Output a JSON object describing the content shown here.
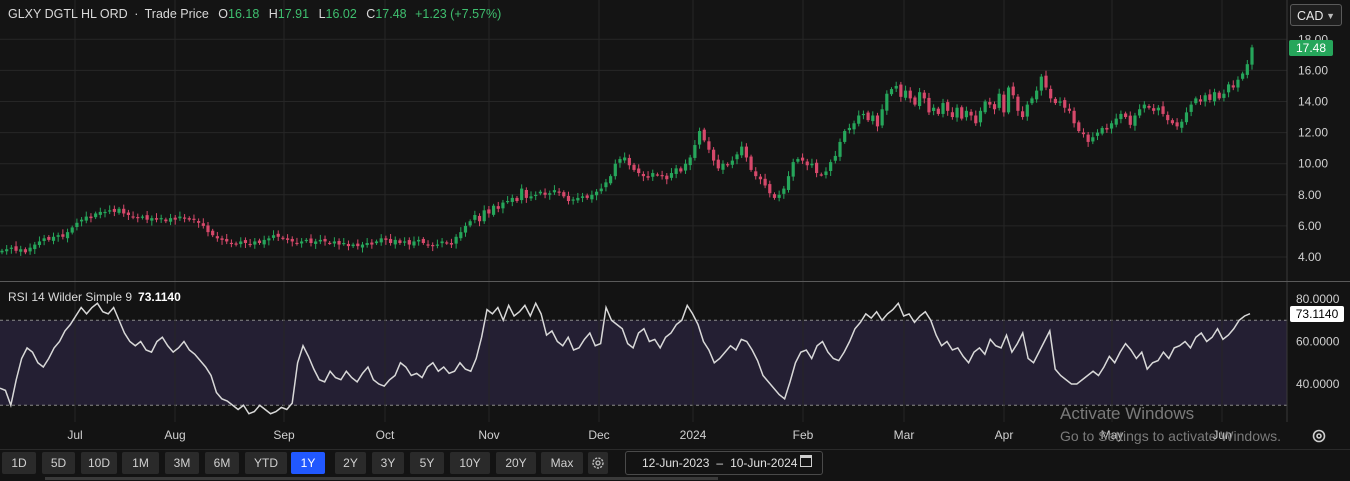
{
  "header": {
    "symbol": "GLXY DGTL HL ORD",
    "price_type": "Trade Price",
    "open_label": "O",
    "open": "16.18",
    "high_label": "H",
    "high": "17.91",
    "low_label": "L",
    "low": "16.02",
    "close_label": "C",
    "close": "17.48",
    "change": "+1.23 (+7.57%)",
    "currency": "CAD"
  },
  "rsi_legend": {
    "label": "RSI 14 Wilder Simple 9",
    "value": "73.1140"
  },
  "badges": {
    "price": "17.48",
    "rsi": "73.1140"
  },
  "toolbar": {
    "timeframes": [
      "1D",
      "5D",
      "10D",
      "1M",
      "3M",
      "6M",
      "YTD",
      "1Y",
      "2Y",
      "3Y",
      "5Y",
      "10Y",
      "20Y",
      "Max"
    ],
    "active": "1Y",
    "range_start": "12-Jun-2023",
    "range_sep": "–",
    "range_end": "10-Jun-2024"
  },
  "watermark": {
    "line1": "Activate Windows",
    "line2": "Go to Settings to activate Windows."
  },
  "colors": {
    "up": "#26a65b",
    "down": "#d6496b",
    "rsi_line": "#d8d8d8",
    "rsi_band": "#241f33",
    "active_button": "#2158ff"
  },
  "chart_data": [
    {
      "type": "candlestick",
      "title": "GLXY DGTL HL ORD · Trade Price",
      "x_tick_labels": [
        "Jul",
        "Aug",
        "Sep",
        "Oct",
        "Nov",
        "Dec",
        "2024",
        "Feb",
        "Mar",
        "Apr",
        "May",
        "Jun"
      ],
      "y_tick_labels": [
        "4.00",
        "6.00",
        "8.00",
        "10.00",
        "12.00",
        "14.00",
        "16.00",
        "18.00"
      ],
      "ylim": [
        3,
        18.5
      ],
      "close_series": [
        4.4,
        4.5,
        4.6,
        4.4,
        4.5,
        4.3,
        4.6,
        4.8,
        5.0,
        5.2,
        5.1,
        5.3,
        5.4,
        5.3,
        5.6,
        5.9,
        6.2,
        6.4,
        6.6,
        6.5,
        6.8,
        6.9,
        6.9,
        7.0,
        6.9,
        7.1,
        6.8,
        6.7,
        6.6,
        6.5,
        6.6,
        6.4,
        6.5,
        6.4,
        6.5,
        6.3,
        6.5,
        6.4,
        6.6,
        6.5,
        6.4,
        6.4,
        6.2,
        6.0,
        5.6,
        5.4,
        5.2,
        5.1,
        5.0,
        4.9,
        4.8,
        5.0,
        4.9,
        4.8,
        5.0,
        4.9,
        5.1,
        5.2,
        5.4,
        5.3,
        5.2,
        5.1,
        5.0,
        4.9,
        5.0,
        5.1,
        4.9,
        5.0,
        5.1,
        5.0,
        4.9,
        5.0,
        4.8,
        4.9,
        4.7,
        4.8,
        4.7,
        4.8,
        4.9,
        4.8,
        5.0,
        5.2,
        5.1,
        4.9,
        5.1,
        4.9,
        5.0,
        4.8,
        5.0,
        5.1,
        4.9,
        4.8,
        4.7,
        4.8,
        5.0,
        4.9,
        4.8,
        5.3,
        5.6,
        6.0,
        6.3,
        6.7,
        6.3,
        7.0,
        6.8,
        7.3,
        7.1,
        7.5,
        7.6,
        7.8,
        7.6,
        8.4,
        7.8,
        7.9,
        8.0,
        8.2,
        8.0,
        8.1,
        8.3,
        8.2,
        7.9,
        7.6,
        7.7,
        7.8,
        7.9,
        7.8,
        8.0,
        8.2,
        8.4,
        8.8,
        9.2,
        10.0,
        10.3,
        10.4,
        9.9,
        9.6,
        9.4,
        9.2,
        9.1,
        9.4,
        9.3,
        9.2,
        9.0,
        9.4,
        9.7,
        9.5,
        10.0,
        10.4,
        11.2,
        12.1,
        11.5,
        10.9,
        10.2,
        9.7,
        10.0,
        9.9,
        10.2,
        10.6,
        11.1,
        10.4,
        9.6,
        9.2,
        9.0,
        8.6,
        8.1,
        7.8,
        8.0,
        8.4,
        9.2,
        10.1,
        10.3,
        10.2,
        9.9,
        10.0,
        9.4,
        9.3,
        9.5,
        10.1,
        10.5,
        11.4,
        12.1,
        12.3,
        12.6,
        13.1,
        13.2,
        12.8,
        13.1,
        12.4,
        13.5,
        14.5,
        14.8,
        15.0,
        14.3,
        14.7,
        14.2,
        13.8,
        14.6,
        14.2,
        13.3,
        13.6,
        13.2,
        13.9,
        13.4,
        13.0,
        13.6,
        12.9,
        13.4,
        13.1,
        12.6,
        13.4,
        14.0,
        13.8,
        13.5,
        14.5,
        13.3,
        14.9,
        14.4,
        13.4,
        13.0,
        13.8,
        14.2,
        14.7,
        15.6,
        14.9,
        14.2,
        13.9,
        14.0,
        13.6,
        13.4,
        12.6,
        12.1,
        11.9,
        11.4,
        11.7,
        12.0,
        12.3,
        12.2,
        12.6,
        12.9,
        13.2,
        13.0,
        12.5,
        13.1,
        13.5,
        13.8,
        13.6,
        13.4,
        13.6,
        13.2,
        12.8,
        12.6,
        12.4,
        12.7,
        13.3,
        13.8,
        14.2,
        14.0,
        14.4,
        14.1,
        14.6,
        14.2,
        14.5,
        15.1,
        14.9,
        15.4,
        15.8,
        16.4,
        17.48
      ]
    },
    {
      "type": "line",
      "title": "RSI 14 Wilder Simple 9",
      "x_tick_labels": [
        "Jul",
        "Aug",
        "Sep",
        "Oct",
        "Nov",
        "Dec",
        "2024",
        "Feb",
        "Mar",
        "Apr",
        "May",
        "Jun"
      ],
      "y_tick_labels": [
        "80.0000",
        "60.0000",
        "40.0000"
      ],
      "ylim": [
        23,
        84
      ],
      "reference_lines": [
        30,
        70
      ],
      "values": [
        38,
        37,
        30,
        42,
        52,
        57,
        55,
        50,
        48,
        52,
        57,
        60,
        65,
        68,
        72,
        76,
        73,
        76,
        78,
        74,
        73,
        76,
        70,
        64,
        60,
        58,
        60,
        56,
        55,
        60,
        62,
        58,
        55,
        57,
        60,
        56,
        54,
        51,
        48,
        44,
        36,
        33,
        32,
        30,
        28,
        30,
        26,
        27,
        30,
        28,
        26,
        27,
        29,
        28,
        31,
        50,
        58,
        53,
        47,
        42,
        41,
        46,
        43,
        42,
        46,
        43,
        41,
        45,
        48,
        42,
        40,
        39,
        42,
        44,
        50,
        48,
        44,
        45,
        43,
        48,
        50,
        46,
        48,
        45,
        46,
        50,
        47,
        46,
        52,
        62,
        75,
        73,
        76,
        70,
        77,
        72,
        74,
        77,
        72,
        78,
        73,
        63,
        65,
        60,
        58,
        62,
        56,
        57,
        61,
        64,
        58,
        59,
        76,
        70,
        68,
        66,
        59,
        57,
        64,
        66,
        60,
        61,
        57,
        62,
        64,
        68,
        70,
        77,
        73,
        68,
        60,
        56,
        50,
        52,
        55,
        58,
        56,
        61,
        60,
        56,
        51,
        44,
        41,
        38,
        35,
        33,
        41,
        50,
        55,
        56,
        52,
        58,
        60,
        55,
        52,
        51,
        55,
        60,
        66,
        69,
        73,
        71,
        74,
        70,
        73,
        75,
        78,
        72,
        73,
        69,
        72,
        74,
        70,
        63,
        58,
        60,
        56,
        57,
        53,
        50,
        55,
        57,
        54,
        61,
        58,
        57,
        63,
        55,
        59,
        64,
        52,
        50,
        55,
        60,
        65,
        47,
        44,
        42,
        40,
        40,
        42,
        44,
        46,
        44,
        48,
        53,
        50,
        55,
        59,
        56,
        52,
        55,
        47,
        50,
        51,
        55,
        52,
        57,
        58,
        60,
        57,
        62,
        64,
        60,
        62,
        66,
        61,
        63,
        66,
        70,
        72,
        73.114
      ]
    }
  ]
}
